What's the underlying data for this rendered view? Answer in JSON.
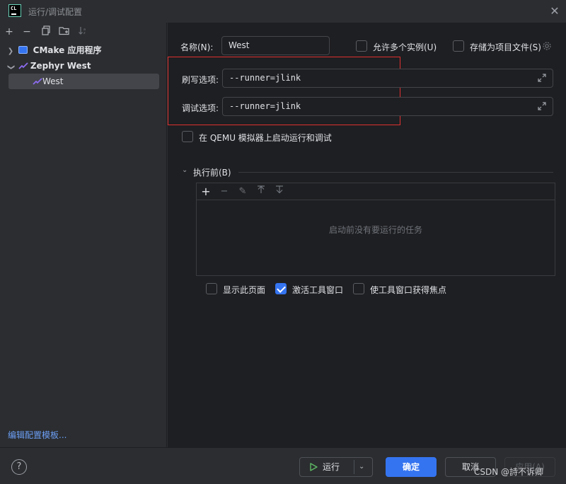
{
  "window": {
    "title": "运行/调试配置",
    "logo_text": "CL"
  },
  "sidebar": {
    "tree": [
      {
        "label": "CMake 应用程序",
        "expanded": false
      },
      {
        "label": "Zephyr West",
        "expanded": true
      },
      {
        "label": "West",
        "selected": true
      }
    ],
    "templates_link": "编辑配置模板..."
  },
  "form": {
    "name_label": "名称(N):",
    "name_value": "West",
    "allow_multiple_label": "允许多个实例(U)",
    "store_as_file_label": "存储为项目文件(S)",
    "flash_label": "刷写选项:",
    "flash_value": "--runner=jlink",
    "debug_label": "调试选项:",
    "debug_value": "--runner=jlink",
    "qemu_label": "在 QEMU 模拟器上启动运行和调试",
    "before_launch_label": "执行前(B)",
    "before_launch_empty": "启动前没有要运行的任务",
    "show_page_label": "显示此页面",
    "activate_tool_label": "激活工具窗口",
    "focus_tool_label": "使工具窗口获得焦点"
  },
  "checkbox_states": {
    "allow_multiple": false,
    "store_as_file": false,
    "qemu": false,
    "show_page": false,
    "activate_tool": true,
    "focus_tool": false
  },
  "buttons": {
    "help": "?",
    "run": "运行",
    "ok": "确定",
    "cancel": "取消",
    "apply": "应用(A)"
  },
  "watermark": "CSDN @詩不诉卿",
  "colors": {
    "accent": "#3574f0",
    "highlight_box": "#e03030",
    "run_icon": "#5fb865"
  }
}
